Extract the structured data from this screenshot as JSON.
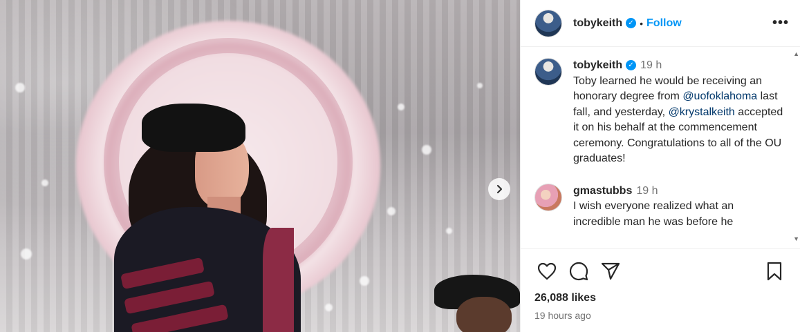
{
  "post": {
    "author": "tobykeith",
    "follow_label": "Follow",
    "separator": "•",
    "more_icon": "more-horizontal-icon",
    "next_icon": "chevron-right-icon"
  },
  "comments": [
    {
      "user": "tobykeith",
      "time": "19 h",
      "text_parts": [
        "Toby learned he would be receiving an honorary degree from ",
        "@uofoklahoma",
        " last fall, and yesterday, ",
        "@krystalkeith",
        " accepted it on his behalf at the commencement ceremony. Congratulations to all of the OU graduates!"
      ]
    },
    {
      "user": "gmastubbs",
      "time": "19 h",
      "text": "I wish everyone realized what an incredible man he was before he"
    }
  ],
  "actions": {
    "like_icon": "heart-icon",
    "comment_icon": "comment-icon",
    "share_icon": "send-icon",
    "save_icon": "bookmark-icon"
  },
  "likes": "26,088 likes",
  "posted_ago": "19 hours ago",
  "colors": {
    "link": "#0095f6",
    "mention": "#00376b",
    "secondary_text": "#737373"
  }
}
